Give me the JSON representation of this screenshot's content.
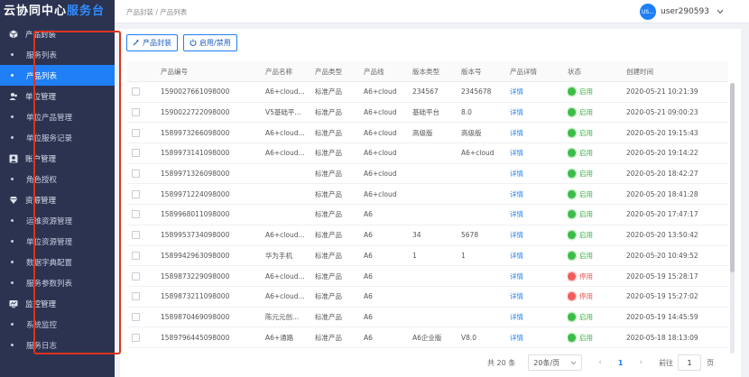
{
  "app": {
    "logo_part1": "云协同中心",
    "logo_part2": "服务台"
  },
  "sidebar": {
    "items": [
      {
        "type": "group",
        "label": "产品封装",
        "icon": "cube-icon"
      },
      {
        "type": "item",
        "label": "服务列表",
        "active": false
      },
      {
        "type": "item",
        "label": "产品列表",
        "active": true
      },
      {
        "type": "group",
        "label": "单位管理",
        "icon": "users-icon"
      },
      {
        "type": "item",
        "label": "单位产品管理",
        "active": false
      },
      {
        "type": "item",
        "label": "单位服务记录",
        "active": false
      },
      {
        "type": "group",
        "label": "账户管理",
        "icon": "account-icon"
      },
      {
        "type": "item",
        "label": "角色授权",
        "active": false
      },
      {
        "type": "group",
        "label": "资源管理",
        "icon": "diamond-icon"
      },
      {
        "type": "item",
        "label": "运维资源管理",
        "active": false
      },
      {
        "type": "item",
        "label": "单位资源管理",
        "active": false
      },
      {
        "type": "item",
        "label": "数据字典配置",
        "active": false
      },
      {
        "type": "item",
        "label": "服务参数列表",
        "active": false
      },
      {
        "type": "group",
        "label": "监控管理",
        "icon": "monitor-icon"
      },
      {
        "type": "item",
        "label": "系统监控",
        "active": false
      },
      {
        "type": "item",
        "label": "服务日志",
        "active": false
      }
    ]
  },
  "header": {
    "breadcrumb": "产品封装 / 产品列表",
    "avatar_text": "US...",
    "username": "user290593"
  },
  "toolbar": {
    "package_label": "产品封装",
    "toggle_label": "启用/禁用"
  },
  "table": {
    "columns": [
      "产品编号",
      "产品名称",
      "产品类型",
      "产品线",
      "版本类型",
      "版本号",
      "产品详情",
      "状态",
      "创建时间"
    ],
    "rows": [
      [
        "1590027661098000",
        "A6+cloud...",
        "标准产品",
        "A6+cloud",
        "234567",
        "2345678",
        "详情",
        "启用",
        "2020-05-21 10:21:39"
      ],
      [
        "1590022722098000",
        "V5基础平...",
        "标准产品",
        "A6+cloud",
        "基础平台",
        "8.0",
        "详情",
        "启用",
        "2020-05-21 09:00:23"
      ],
      [
        "1589973266098000",
        "A6+cloud...",
        "标准产品",
        "A6+cloud",
        "高级版",
        "高级版",
        "详情",
        "启用",
        "2020-05-20 19:15:43"
      ],
      [
        "1589973141098000",
        "A6+cloud...",
        "标准产品",
        "A6+cloud",
        "",
        "A6+cloud",
        "详情",
        "启用",
        "2020-05-20 19:14:22"
      ],
      [
        "1589971326098000",
        "",
        "标准产品",
        "A6+cloud",
        "",
        "",
        "详情",
        "启用",
        "2020-05-20 18:42:27"
      ],
      [
        "1589971224098000",
        "",
        "标准产品",
        "A6+cloud",
        "",
        "",
        "详情",
        "启用",
        "2020-05-20 18:41:28"
      ],
      [
        "1589968011098000",
        "",
        "标准产品",
        "A6",
        "",
        "",
        "详情",
        "启用",
        "2020-05-20 17:47:17"
      ],
      [
        "1589953734098000",
        "A6+cloud...",
        "标准产品",
        "A6",
        "34",
        "5678",
        "详情",
        "启用",
        "2020-05-20 13:50:42"
      ],
      [
        "1589942963098000",
        "华为手机",
        "标准产品",
        "A6",
        "1",
        "1",
        "详情",
        "启用",
        "2020-05-20 10:49:52"
      ],
      [
        "1589873229098000",
        "A6+cloud...",
        "标准产品",
        "A6",
        "",
        "",
        "详情",
        "停用",
        "2020-05-19 15:28:17"
      ],
      [
        "1589873211098000",
        "A6+cloud...",
        "标准产品",
        "A6",
        "",
        "",
        "详情",
        "停用",
        "2020-05-19 15:27:02"
      ],
      [
        "1589870469098000",
        "陈元元创...",
        "标准产品",
        "A6",
        "",
        "",
        "详情",
        "启用",
        "2020-05-19 14:45:59"
      ],
      [
        "1589796445098000",
        "A6+通路",
        "标准产品",
        "A6",
        "A6企业版",
        "V8.0",
        "详情",
        "启用",
        "2020-05-18 18:13:09"
      ]
    ]
  },
  "pagination": {
    "total": "共 20 条",
    "page_size": "20条/页",
    "prev": "‹",
    "current": "1",
    "next": "›",
    "goto_label": "前往",
    "goto_value": "1",
    "page_suffix": "页"
  },
  "colors": {
    "sidebar_bg": "#2b3350",
    "accent": "#1f7ff7",
    "enabled": "#3cbd49",
    "disabled": "#f15d5d",
    "highlight": "#e0321e"
  }
}
